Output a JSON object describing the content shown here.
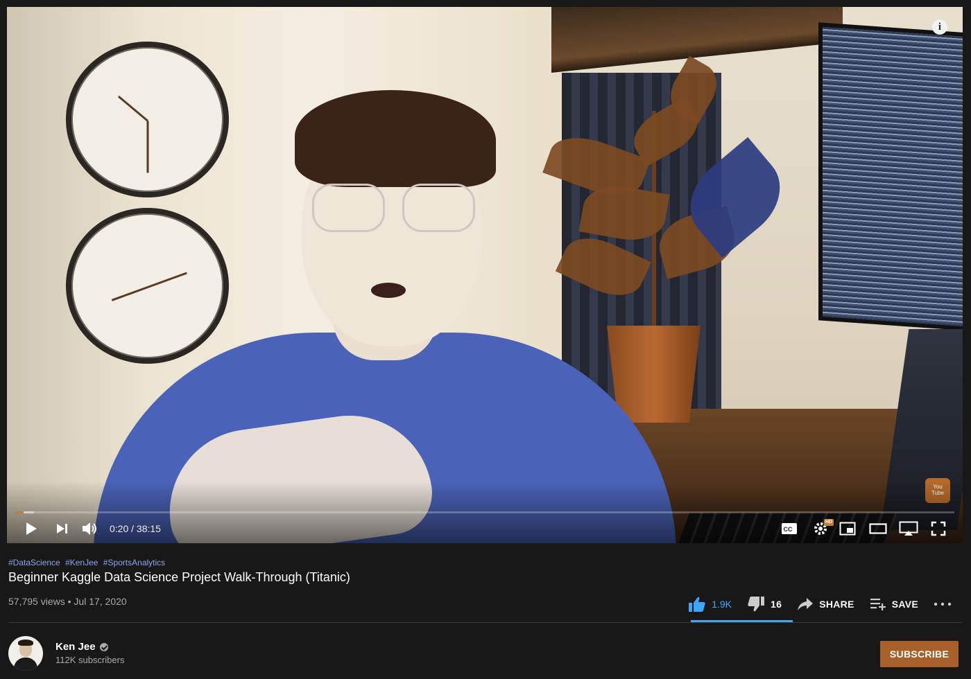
{
  "video": {
    "current_time": "0:20",
    "duration": "38:15",
    "progress_fraction": 0.0087,
    "buffered_fraction": 0.02,
    "time_separator": " / "
  },
  "player_controls": {
    "icons": [
      "play-icon",
      "next-icon",
      "volume-icon",
      "captions-icon",
      "settings-icon",
      "miniplayer-icon",
      "theater-icon",
      "cast-icon",
      "fullscreen-icon"
    ],
    "hd_badge": "HD",
    "watermark_text": "YouTube SUBSCRIBE"
  },
  "hashtags": [
    "#DataScience",
    "#KenJee",
    "#SportsAnalytics"
  ],
  "title": "Beginner Kaggle Data Science Project Walk-Through (Titanic)",
  "meta": {
    "views": "57,795 views",
    "separator": "•",
    "date": "Jul 17, 2020"
  },
  "actions": {
    "likes": "1.9K",
    "dislikes": "16",
    "share_label": "SHARE",
    "save_label": "SAVE"
  },
  "channel": {
    "name": "Ken Jee",
    "subscribers": "112K subscribers",
    "subscribe_label": "SUBSCRIBE"
  },
  "colors": {
    "background": "#181818",
    "accent_like": "#3ea6ff",
    "subscribe_button": "#a8602a",
    "progress_played": "#c0802f",
    "hashtag": "#8ea6e8"
  }
}
